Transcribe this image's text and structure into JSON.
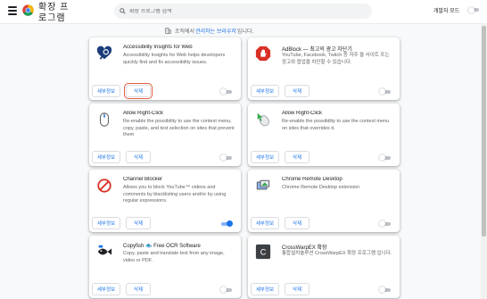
{
  "header": {
    "title": "확장 프로그램",
    "search_placeholder": "확장 프로그램 검색",
    "dev_mode_label": "개발자 모드"
  },
  "managed_notice": {
    "prefix": "조직에서",
    "link": "관리하는 브라우저",
    "suffix": "입니다."
  },
  "extensions": [
    {
      "name": "Accessibility Insights for Web",
      "description": "Accessibility Insights for Web helps developers quickly find and fix accessibility issues.",
      "details_label": "세부정보",
      "remove_label": "삭제",
      "enabled": false,
      "icon": "heart-magnifier-icon"
    },
    {
      "name": "AdBlock — 최고의 광고 차단기",
      "description": "YouTube, Facebook, Twitch 등 자주 쓸 사이트 또는 광고와 팝업을 차단할 수 있습니다.",
      "details_label": "세부정보",
      "remove_label": "삭제",
      "enabled": false,
      "icon": "adblock-hand-icon"
    },
    {
      "name": "Allow Right-Click",
      "description": "Re-enable the possibility to use the context menu, copy, paste, and text selection on sites that prevent them",
      "details_label": "세부정보",
      "remove_label": "삭제",
      "enabled": false,
      "icon": "mouse-icon"
    },
    {
      "name": "Allow Right-Click",
      "description": "Re-enable the possibility to use the context menu on sites that overrides it.",
      "details_label": "세부정보",
      "remove_label": "삭제",
      "enabled": false,
      "icon": "mouse-cursor-icon"
    },
    {
      "name": "Channel Blocker",
      "description": "Allows you to block YouTube™ videos and comments by blacklisting users and/or by using regular expressions.",
      "details_label": "세부정보",
      "remove_label": "삭제",
      "enabled": true,
      "icon": "block-icon"
    },
    {
      "name": "Chrome Remote Desktop",
      "description": "Chrome Remote Desktop extension",
      "details_label": "세부정보",
      "remove_label": "삭제",
      "enabled": false,
      "icon": "remote-desktop-icon"
    },
    {
      "name": "Copyfish 🐟 Free OCR Software",
      "description": "Copy, paste and translate text from any image, video or PDF.",
      "details_label": "세부정보",
      "remove_label": "삭제",
      "enabled": false,
      "icon": "copyfish-icon"
    },
    {
      "name": "CrossWarpEX 확장",
      "description": "통합설치솔루션 CrossWarpEX 확장 프로그램 입니다.",
      "details_label": "세부정보",
      "remove_label": "삭제",
      "enabled": false,
      "icon": "crosswarp-c-icon"
    }
  ]
}
